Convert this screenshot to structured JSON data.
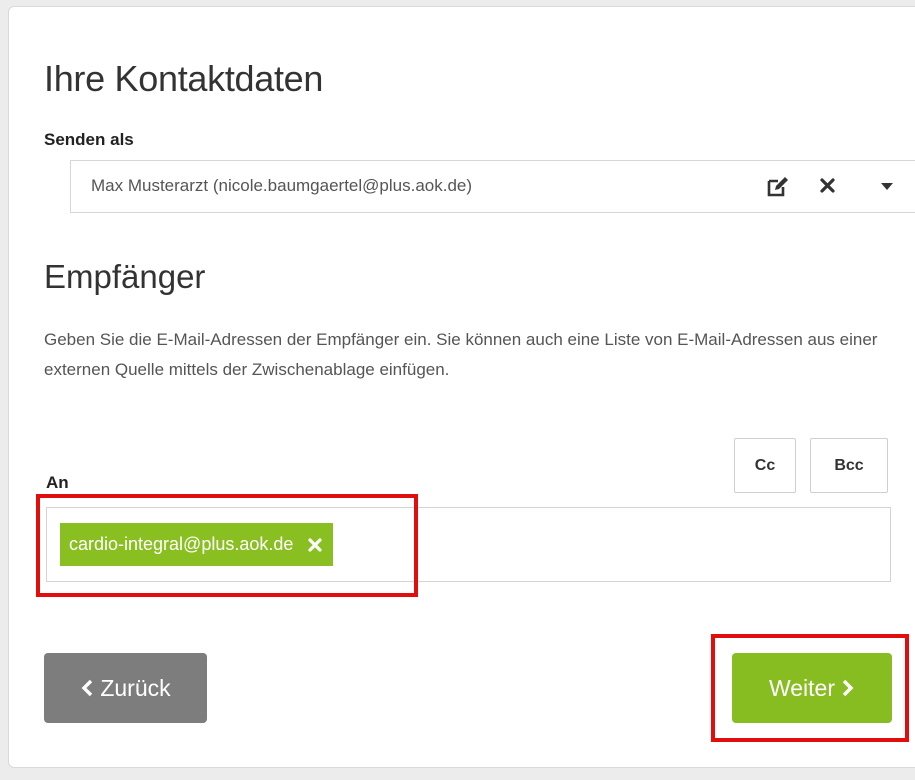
{
  "contact": {
    "heading": "Ihre Kontaktdaten",
    "send_as_label": "Senden als",
    "send_as_value": "Max Musterarzt (nicole.baumgaertel@plus.aok.de)",
    "icons": [
      "edit-icon",
      "clear-icon",
      "dropdown-caret-icon"
    ]
  },
  "recipients": {
    "heading": "Empfänger",
    "description": "Geben Sie die E-Mail-Adressen der Empfänger ein. Sie können auch eine Liste von E-Mail-Adressen aus einer externen Quelle mittels der Zwischenablage einfügen.",
    "to_label": "An",
    "cc_label": "Cc",
    "bcc_label": "Bcc",
    "chips": [
      "cardio-integral@plus.aok.de"
    ]
  },
  "navigation": {
    "back_label": "Zurück",
    "next_label": "Weiter"
  },
  "colors": {
    "accent_green": "#88bd21",
    "back_gray": "#7d7d7d",
    "highlight_red": "#e10e0e"
  }
}
